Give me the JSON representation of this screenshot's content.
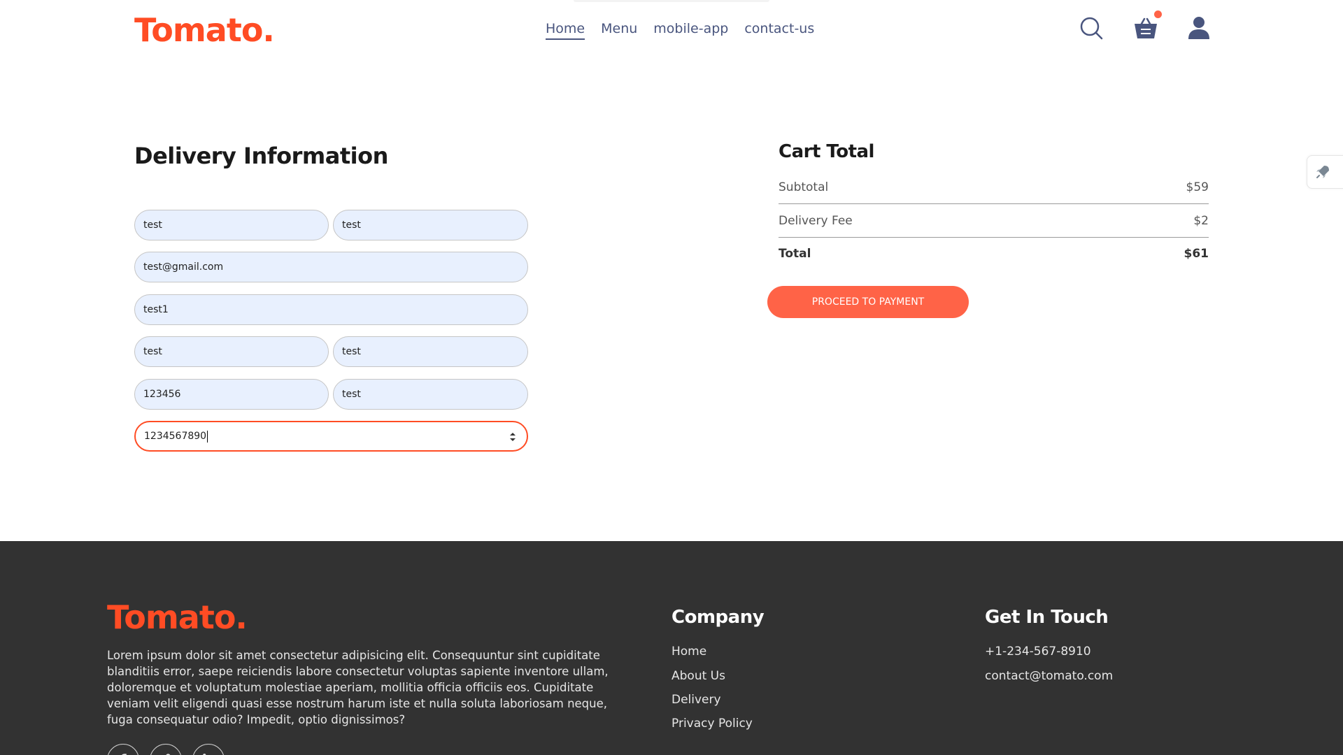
{
  "brand": {
    "logo": "Tomato.",
    "accent": "#ff4c24",
    "button_color": "#ff6347"
  },
  "nav": {
    "items": [
      "Home",
      "Menu",
      "mobile-app",
      "contact-us"
    ],
    "active": "Home"
  },
  "header_icons": [
    "search-icon",
    "basket-icon",
    "profile-icon"
  ],
  "delivery": {
    "title": "Delivery Information",
    "first_name": "test",
    "last_name": "test",
    "email": "test@gmail.com",
    "street": "test1",
    "city": "test",
    "state": "test",
    "zip": "123456",
    "country": "test",
    "phone": "1234567890"
  },
  "cart": {
    "title": "Cart Total",
    "subtotal_label": "Subtotal",
    "subtotal": "$59",
    "delivery_label": "Delivery Fee",
    "delivery_fee": "$2",
    "total_label": "Total",
    "total": "$61",
    "button": "PROCEED TO PAYMENT"
  },
  "footer": {
    "logo": "Tomato.",
    "description": "Lorem ipsum dolor sit amet consectetur adipisicing elit. Consequuntur sint cupiditate blanditiis error, saepe reiciendis labore consectetur voluptas sapiente inventore ullam, doloremque et voluptatum molestiae aperiam, mollitia officia officiis eos. Cupiditate veniam velit eligendi quasi esse nostrum harum iste et nulla soluta laboriosam neque, fuga consequatur odio? Impedit, optio dignissimos?",
    "company_title": "Company",
    "company_links": [
      "Home",
      "About Us",
      "Delivery",
      "Privacy Policy"
    ],
    "contact_title": "Get In Touch",
    "phone": "+1-234-567-8910",
    "email": "contact@tomato.com",
    "social_icons": [
      "facebook-icon",
      "twitter-icon",
      "linkedin-icon"
    ]
  }
}
